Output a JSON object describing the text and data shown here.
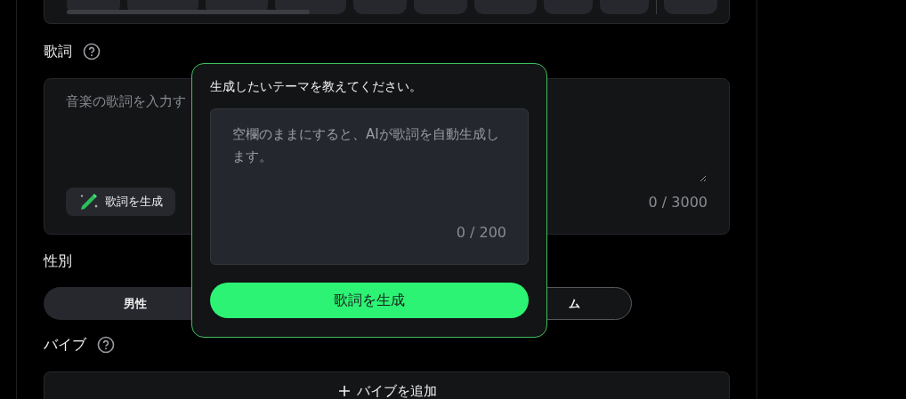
{
  "lyrics": {
    "label": "歌詞",
    "placeholder": "音楽の歌詞を入力す",
    "generate_button": "歌詞を生成",
    "counter": "0 / 3000"
  },
  "gender": {
    "label": "性別",
    "options": [
      {
        "label": "男性",
        "selected": true
      },
      {
        "label": "ム",
        "selected": false
      }
    ]
  },
  "vibe": {
    "label": "バイブ",
    "add_button": "バイブを追加"
  },
  "popup": {
    "title": "生成したいテーマを教えてください。",
    "placeholder": "空欄のままにすると、AIが歌詞を自動生成します。",
    "counter": "0 / 200",
    "submit": "歌詞を生成"
  }
}
